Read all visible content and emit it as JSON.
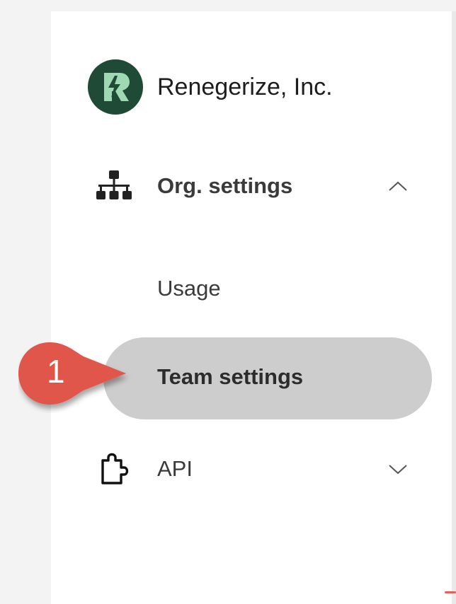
{
  "org": {
    "name": "Renegerize, Inc.",
    "logo_icon": "renegerize-logo-icon",
    "logo_color": "#1f4a35"
  },
  "nav": {
    "org_settings": {
      "label": "Org. settings",
      "icon": "org-chart-icon",
      "expanded": true,
      "chevron": "chevron-up-icon",
      "items": [
        {
          "label": "Usage"
        },
        {
          "label": "Team settings",
          "selected": true
        }
      ]
    },
    "api": {
      "label": "API",
      "icon": "puzzle-icon",
      "expanded": false,
      "chevron": "chevron-down-icon"
    }
  },
  "callout": {
    "number": "1",
    "color": "#e0564c"
  },
  "colors": {
    "selected_bg": "#cdcdcd",
    "panel_bg": "#ffffff"
  }
}
